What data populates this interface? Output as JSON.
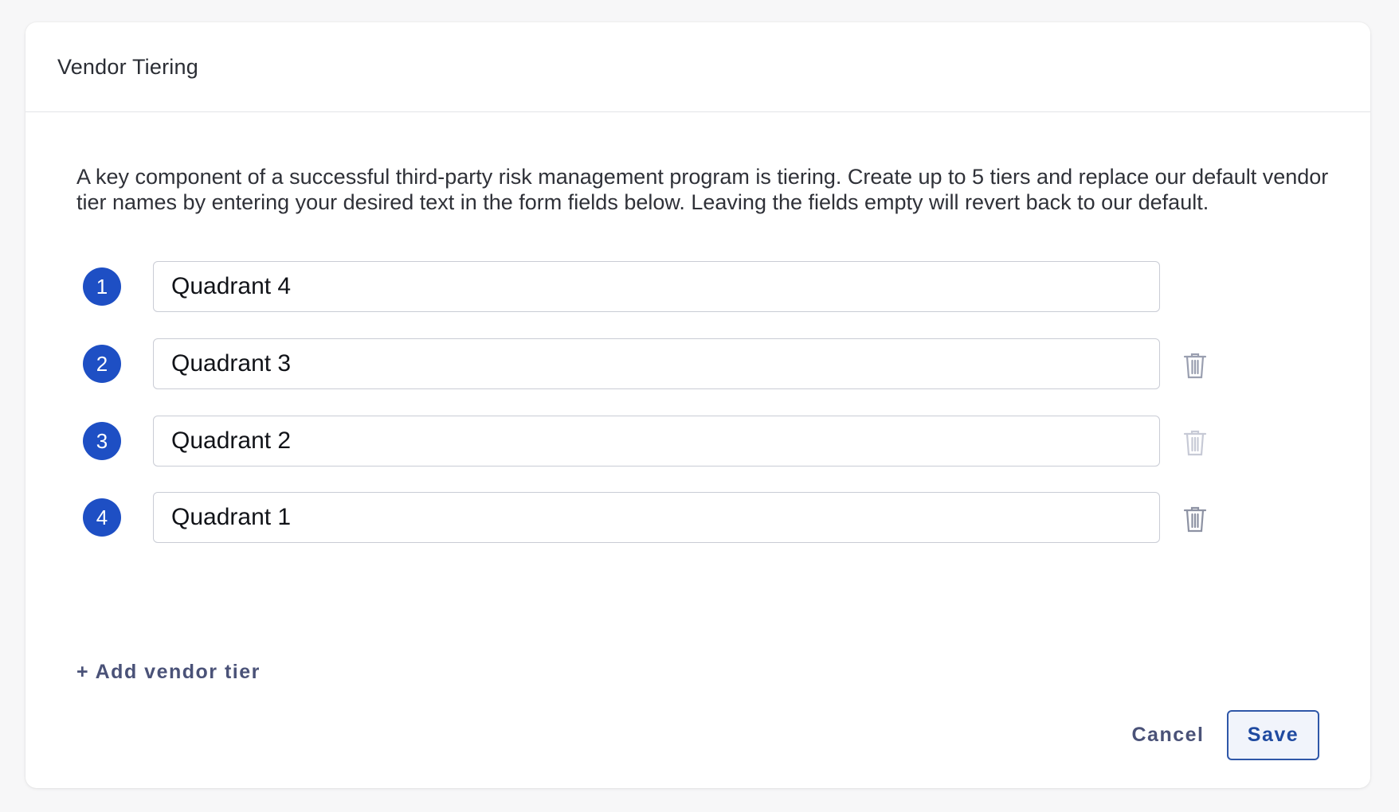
{
  "card": {
    "title": "Vendor Tiering",
    "description": "A key component of a successful third-party risk management program is tiering. Create up to 5 tiers and replace our default vendor tier names by entering your desired text in the form fields below. Leaving the fields empty will revert back to our default."
  },
  "tiers": [
    {
      "number": "1",
      "value": "Quadrant 4",
      "deletable": false
    },
    {
      "number": "2",
      "value": "Quadrant 3",
      "deletable": true,
      "trash_color": "#9a9fb0"
    },
    {
      "number": "3",
      "value": "Quadrant 2",
      "deletable": true,
      "trash_color": "#c7cad6"
    },
    {
      "number": "4",
      "value": "Quadrant 1",
      "deletable": true,
      "trash_color": "#8d92a3"
    }
  ],
  "actions": {
    "add_tier_label": "+ Add vendor tier",
    "cancel_label": "Cancel",
    "save_label": "Save"
  },
  "colors": {
    "badge": "#1e4fc4",
    "save_border": "#2f57a8",
    "link_text": "#4a5278"
  },
  "icons": {
    "delete": "trash-icon"
  }
}
